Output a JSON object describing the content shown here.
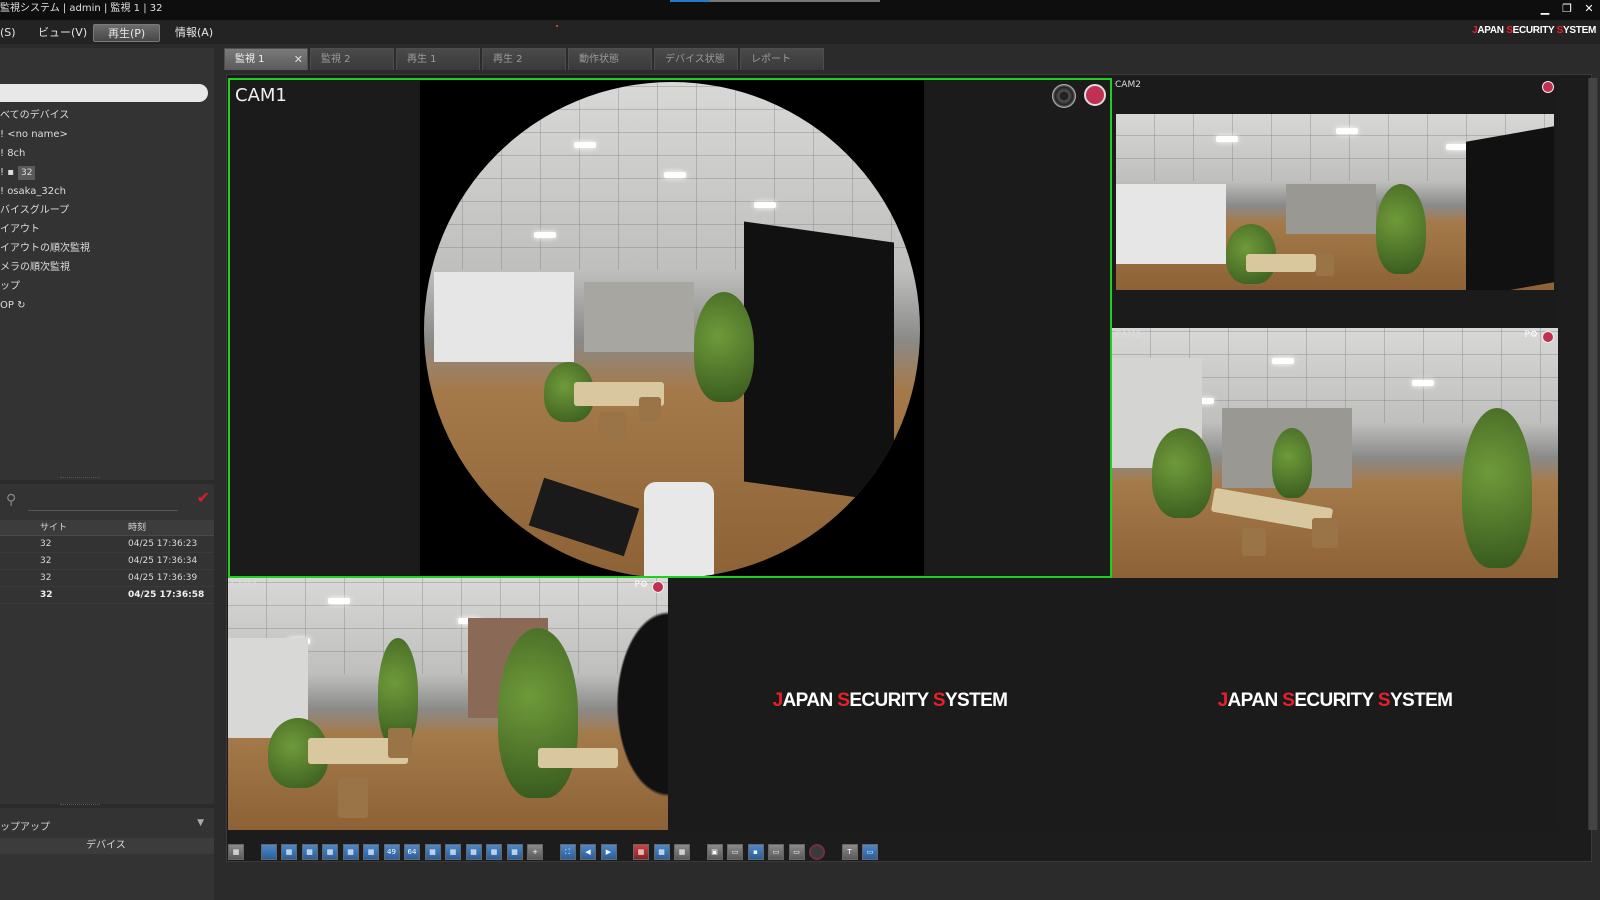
{
  "window": {
    "title": "監視システム | admin | 監視 1 | 32",
    "min_icon": "minimize-icon",
    "max_icon": "maximize-icon",
    "close_icon": "close-icon"
  },
  "menu": {
    "items": [
      "(S)",
      "ビュー(V)",
      "再生(P)",
      "情報(A)"
    ],
    "active": "再生(P)",
    "brand": {
      "prefix_red": "J",
      "part1": "APAN ",
      "s1": "S",
      "part2": "ECURITY ",
      "s2": "S",
      "part3": "YSTEM"
    }
  },
  "left_panel": {
    "tree": [
      {
        "label": "べてのデバイス"
      },
      {
        "label": "! <no name>"
      },
      {
        "label": "! 8ch"
      },
      {
        "label": "! ▪",
        "badge": "32"
      },
      {
        "label": "! osaka_32ch"
      },
      {
        "label": "バイスグループ"
      },
      {
        "label": "イアウト"
      },
      {
        "label": "イアウトの順次監視"
      },
      {
        "label": "メラの順次監視"
      },
      {
        "label": "ップ"
      },
      {
        "label": "OP  ↻"
      }
    ],
    "events": {
      "search_icon": "search-icon",
      "check_icon": "checkmark-icon",
      "headers": [
        "",
        "サイト",
        "時刻"
      ],
      "rows": [
        {
          "site": "32",
          "time": "04/25 17:36:23",
          "bold": false
        },
        {
          "site": "32",
          "time": "04/25 17:36:34",
          "bold": false
        },
        {
          "site": "32",
          "time": "04/25 17:36:39",
          "bold": false
        },
        {
          "site": "32",
          "time": "04/25 17:36:58",
          "bold": true
        }
      ]
    },
    "popup": {
      "title": "ップアップ",
      "arrow": "▼",
      "header": "デバイス"
    }
  },
  "tabs": [
    {
      "label": "監視 1",
      "active": true,
      "closable": true
    },
    {
      "label": "監視 2",
      "active": false
    },
    {
      "label": "再生 1",
      "active": false
    },
    {
      "label": "再生 2",
      "active": false
    },
    {
      "label": "動作状態",
      "active": false
    },
    {
      "label": "デバイス状態",
      "active": false
    },
    {
      "label": "レポート",
      "active": false
    }
  ],
  "cameras": {
    "cam1": {
      "label": "CAM1"
    },
    "cam2": {
      "label": "CAM2"
    },
    "cam3": {
      "label": "CAM3",
      "ptz": "P⚙"
    },
    "cam4": {
      "label": "CAM4",
      "ptz": "P⚙"
    }
  },
  "empty_logo": {
    "j": "J",
    "apan": "APAN ",
    "s1": "S",
    "ecurity": "ECURITY ",
    "s2": "S",
    "ystem": "YSTEM"
  },
  "toolbar": {
    "layout_labels": [
      "49",
      "64"
    ],
    "tool_text_icon": "T"
  },
  "colors": {
    "selected_border": "#20d020",
    "brand_red": "#e8202a",
    "record": "#c03050"
  }
}
